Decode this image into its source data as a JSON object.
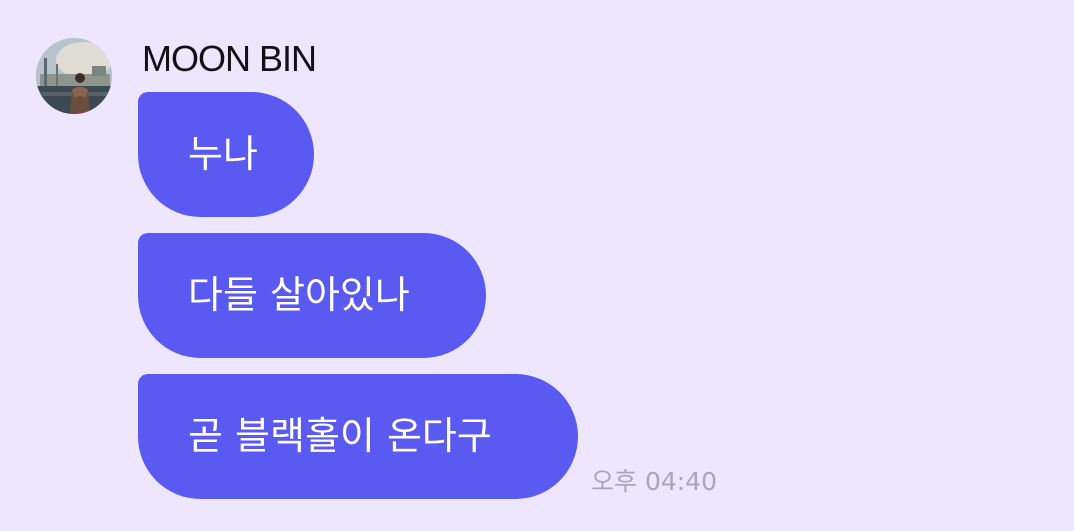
{
  "sender": {
    "name": "MOON BIN",
    "avatar_icon": "profile-photo"
  },
  "messages": [
    {
      "text": "누나"
    },
    {
      "text": "다들 살아있나"
    },
    {
      "text": "곧 블랙홀이 온다구"
    }
  ],
  "timestamp": "오후 04:40",
  "colors": {
    "background": "#EEE6FF",
    "bubble": "#5A5AF2",
    "bubble_text": "#FFFFFF",
    "name_text": "#111111",
    "timestamp_text": "#ABA5B8"
  }
}
